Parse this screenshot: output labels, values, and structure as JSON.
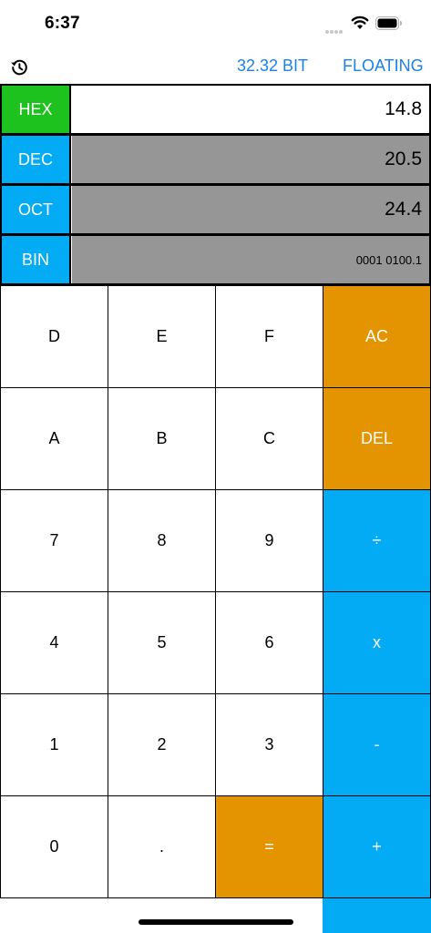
{
  "status": {
    "time": "6:37"
  },
  "toolbar": {
    "bit_label": "32.32 BIT",
    "mode_label": "FLOATING"
  },
  "bases": [
    {
      "label": "HEX",
      "value": "14.8"
    },
    {
      "label": "DEC",
      "value": "20.5"
    },
    {
      "label": "OCT",
      "value": "24.4"
    },
    {
      "label": "BIN",
      "value": "0001 0100.1"
    }
  ],
  "keys": {
    "d": "D",
    "e": "E",
    "f": "F",
    "ac": "AC",
    "a": "A",
    "b": "B",
    "c": "C",
    "del": "DEL",
    "seven": "7",
    "eight": "8",
    "nine": "9",
    "divide": "÷",
    "four": "4",
    "five": "5",
    "six": "6",
    "multiply": "x",
    "one": "1",
    "two": "2",
    "three": "3",
    "minus": "-",
    "zero": "0",
    "dot": ".",
    "equals": "=",
    "plus": "+"
  },
  "colors": {
    "accent_blue": "#03abf4",
    "accent_orange": "#e49400",
    "hex_green": "#1ec21e",
    "link_blue": "#1a82e8",
    "value_gray": "#969696"
  },
  "icons": [
    "history-icon",
    "wifi-icon",
    "battery-icon",
    "signal-icon"
  ]
}
